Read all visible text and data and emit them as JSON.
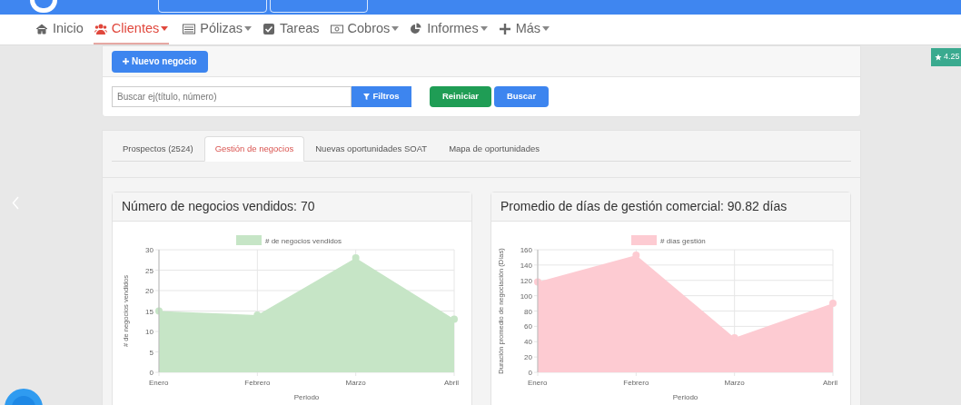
{
  "nav": [
    {
      "label": "Inicio",
      "kind": "home",
      "dropdown": false,
      "selected": false
    },
    {
      "label": "Clientes",
      "kind": "users",
      "dropdown": true,
      "selected": true
    },
    {
      "label": "Pólizas",
      "kind": "list",
      "dropdown": true,
      "selected": false
    },
    {
      "label": "Tareas",
      "kind": "check",
      "dropdown": false,
      "selected": false
    },
    {
      "label": "Cobros",
      "kind": "money",
      "dropdown": true,
      "selected": false
    },
    {
      "label": "Informes",
      "kind": "pie",
      "dropdown": true,
      "selected": false
    },
    {
      "label": "Más",
      "kind": "plus",
      "dropdown": true,
      "selected": false
    }
  ],
  "rating_badge": "4.25",
  "new_button": "Nuevo negocio",
  "search": {
    "placeholder": "Buscar ej(título, número)",
    "filter_button": "Filtros",
    "reset_button": "Reiniciar",
    "search_button": "Buscar"
  },
  "tabs": [
    {
      "label": "Prospectos (2524)",
      "selected": false
    },
    {
      "label": "Gestión de negocios",
      "selected": true
    },
    {
      "label": "Nuevas oportunidades SOAT",
      "selected": false
    },
    {
      "label": "Mapa de oportunidades",
      "selected": false
    }
  ],
  "charts": [
    {
      "title": "Número de negocios vendidos: 70",
      "chart_data": {
        "type": "area",
        "xlabel": "Periodo",
        "ylabel": "# de negocios vendidos",
        "categories": [
          "Enero",
          "Febrero",
          "Marzo",
          "Abril"
        ],
        "series": [
          {
            "name": "# de negocios vendidos",
            "color": "#c6e5c6",
            "values": [
              15,
              14,
              28,
              13
            ]
          }
        ],
        "ylim": [
          0,
          30
        ],
        "yticks": [
          0,
          5,
          10,
          15,
          20,
          25,
          30
        ],
        "grid": true
      }
    },
    {
      "title": "Promedio de días de gestión comercial: 90.82 días",
      "chart_data": {
        "type": "area",
        "xlabel": "Periodo",
        "ylabel": "Duración promedio de negociación (Días)",
        "categories": [
          "Enero",
          "Febrero",
          "Marzo",
          "Abril"
        ],
        "series": [
          {
            "name": "# días gestión",
            "color": "#fdcbd2",
            "values": [
              118,
              153,
              45,
              90
            ]
          }
        ],
        "ylim": [
          0,
          160
        ],
        "yticks": [
          0,
          20,
          40,
          60,
          80,
          100,
          120,
          140,
          160
        ],
        "grid": true
      }
    }
  ]
}
